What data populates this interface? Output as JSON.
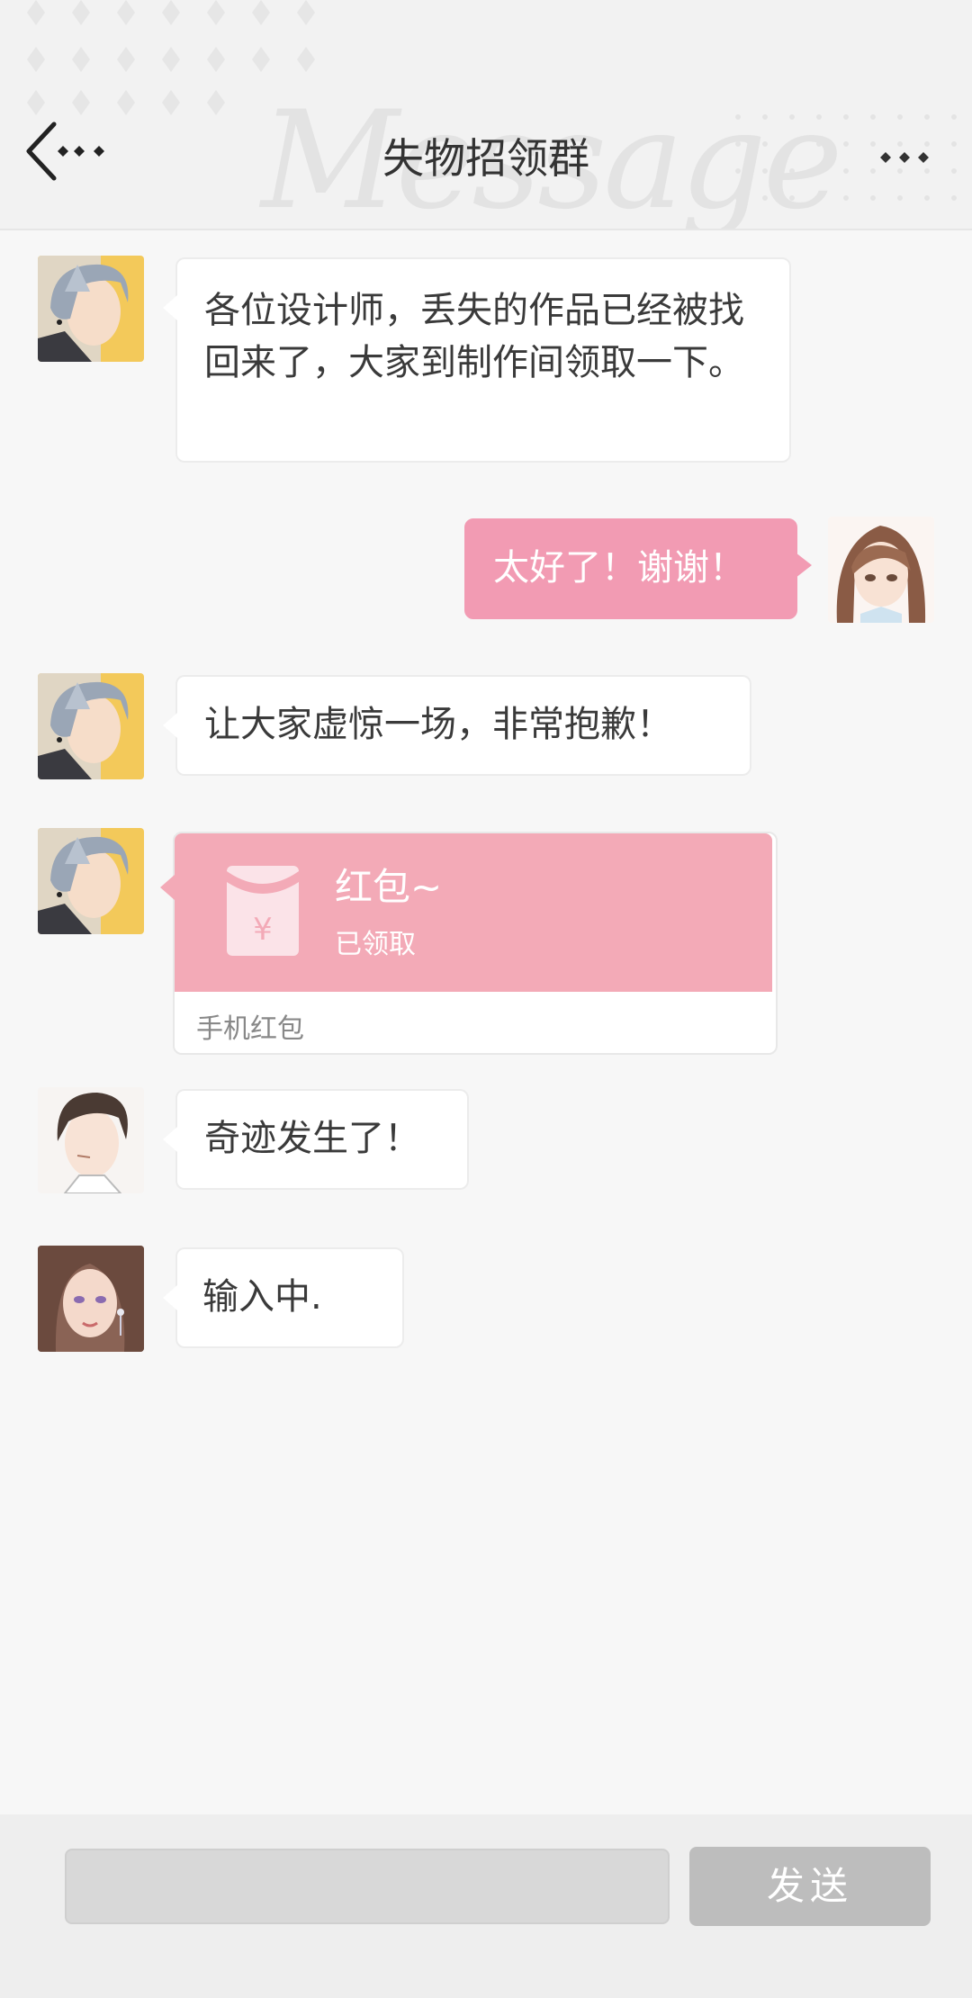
{
  "header": {
    "title": "失物招领群",
    "watermark": "Message",
    "back_icon": "back-arrow-icon",
    "more_icon": "more-dots-icon"
  },
  "messages": [
    {
      "side": "left",
      "avatar": "silver-hair-man-avatar",
      "text": "各位设计师，丢失的作品已经被找回来了，大家到制作间领取一下。"
    },
    {
      "side": "right",
      "avatar": "brown-hair-girl-avatar",
      "text": "太好了！谢谢！"
    },
    {
      "side": "left",
      "avatar": "silver-hair-man-avatar",
      "text": "让大家虚惊一场，非常抱歉！"
    },
    {
      "side": "left",
      "avatar": "silver-hair-man-avatar",
      "type": "red-packet",
      "red_packet": {
        "title": "红包~",
        "status": "已领取",
        "footer": "手机红包",
        "icon": "red-envelope-icon"
      }
    },
    {
      "side": "left",
      "avatar": "dark-hair-man-avatar",
      "text": "奇迹发生了！"
    },
    {
      "side": "left",
      "avatar": "woman-earring-avatar",
      "text": "输入中."
    }
  ],
  "input": {
    "value": "",
    "placeholder": ""
  },
  "send_button": {
    "label": "发送"
  },
  "colors": {
    "accent_pink": "#f29bb3",
    "red_packet": "#f3aab7",
    "send_disabled": "#bdbdbd"
  }
}
